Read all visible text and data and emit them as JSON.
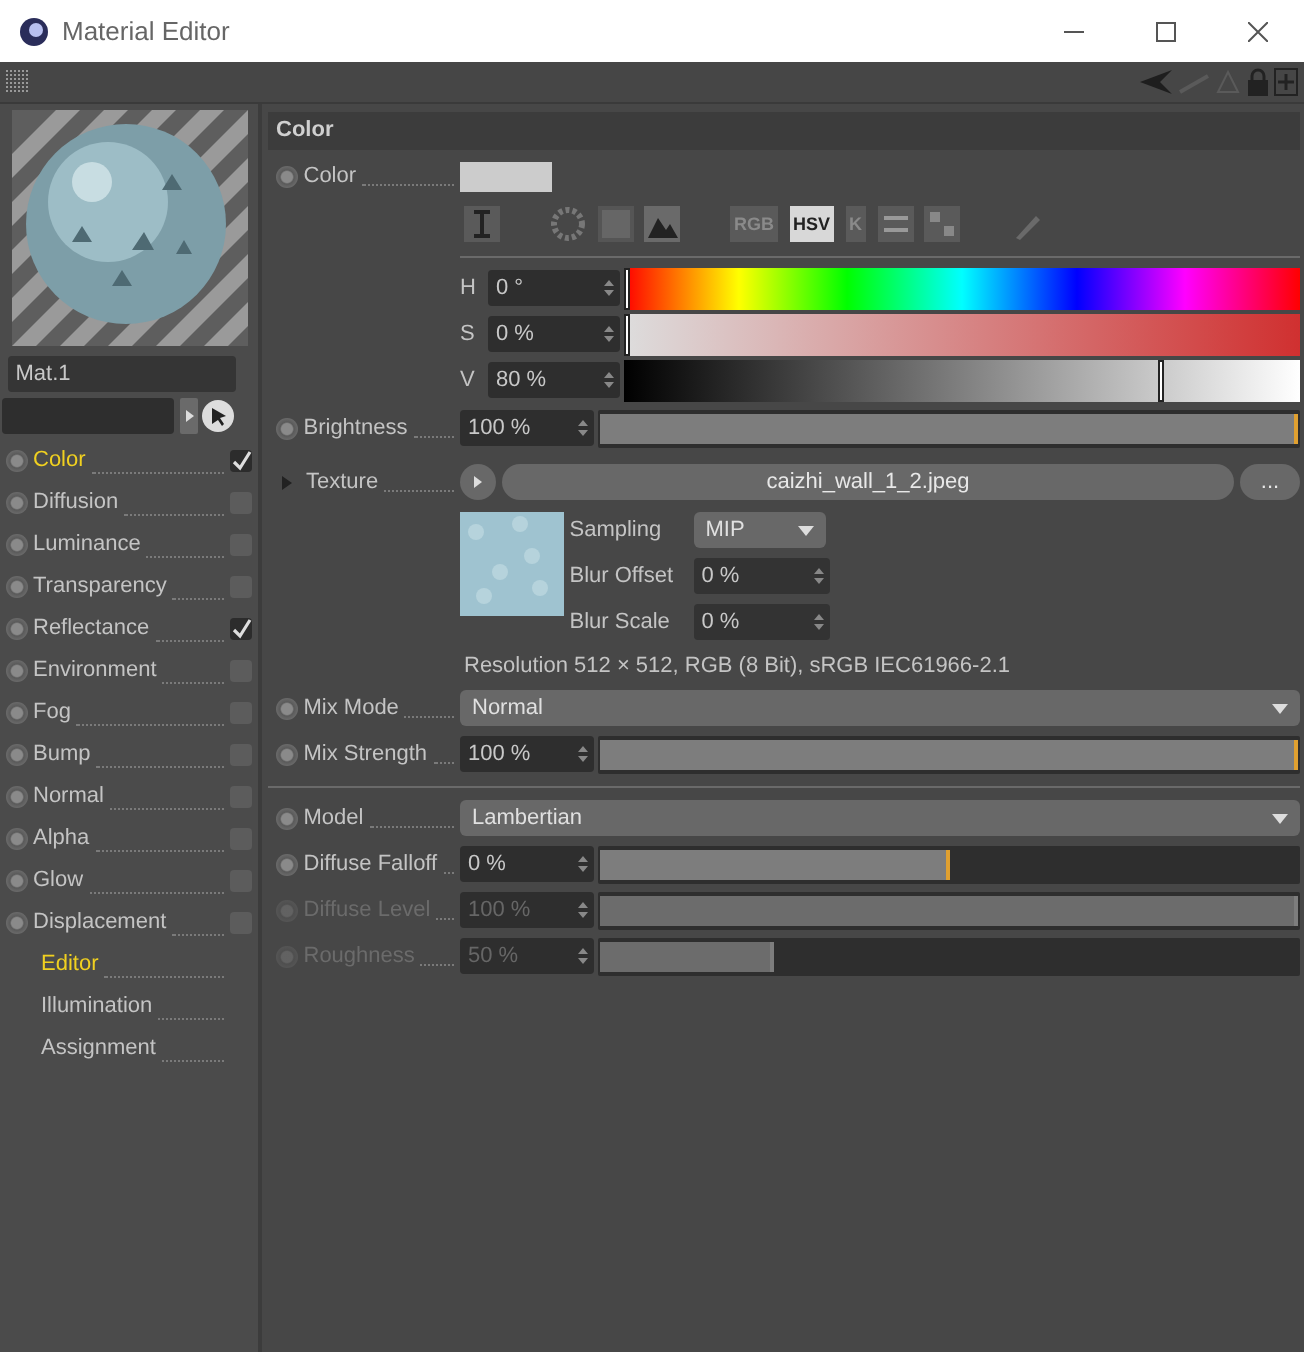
{
  "window": {
    "title": "Material Editor"
  },
  "material": {
    "name": "Mat.1"
  },
  "channels": [
    {
      "kind": "channel",
      "label": "Color",
      "checked": true,
      "selected": true
    },
    {
      "kind": "channel",
      "label": "Diffusion",
      "checked": false,
      "selected": false
    },
    {
      "kind": "channel",
      "label": "Luminance",
      "checked": false,
      "selected": false
    },
    {
      "kind": "channel",
      "label": "Transparency",
      "checked": false,
      "selected": false
    },
    {
      "kind": "channel",
      "label": "Reflectance",
      "checked": true,
      "selected": false
    },
    {
      "kind": "channel",
      "label": "Environment",
      "checked": false,
      "selected": false
    },
    {
      "kind": "channel",
      "label": "Fog",
      "checked": false,
      "selected": false
    },
    {
      "kind": "channel",
      "label": "Bump",
      "checked": false,
      "selected": false
    },
    {
      "kind": "channel",
      "label": "Normal",
      "checked": false,
      "selected": false
    },
    {
      "kind": "channel",
      "label": "Alpha",
      "checked": false,
      "selected": false
    },
    {
      "kind": "channel",
      "label": "Glow",
      "checked": false,
      "selected": false
    },
    {
      "kind": "channel",
      "label": "Displacement",
      "checked": false,
      "selected": false
    },
    {
      "kind": "page",
      "label": "Editor",
      "selected": true
    },
    {
      "kind": "page",
      "label": "Illumination",
      "selected": false
    },
    {
      "kind": "page",
      "label": "Assignment",
      "selected": false
    }
  ],
  "section": {
    "title": "Color"
  },
  "color": {
    "label": "Color",
    "modes": [
      {
        "label": "RGB",
        "selected": false
      },
      {
        "label": "HSV",
        "selected": true
      },
      {
        "label": "K",
        "selected": false
      }
    ],
    "sliders": [
      {
        "kind": "hue",
        "label": "H",
        "value": "0 °",
        "level": 0
      },
      {
        "kind": "saturation",
        "label": "S",
        "value": "0 %",
        "level": 0
      },
      {
        "kind": "value",
        "label": "V",
        "value": "80 %",
        "level": 0.8
      }
    ]
  },
  "brightness": {
    "label": "Brightness",
    "value": "100 %",
    "level": 1
  },
  "texture": {
    "label": "Texture",
    "file": "caizhi_wall_1_2.jpeg",
    "browse": "...",
    "options": [
      {
        "kind": "dropdown",
        "label": "Sampling",
        "value": "MIP"
      },
      {
        "kind": "spinner",
        "label": "Blur Offset",
        "value": "0 %"
      },
      {
        "kind": "spinner",
        "label": "Blur Scale",
        "value": "0 %"
      }
    ],
    "resolution": "Resolution 512 × 512, RGB (8 Bit), sRGB IEC61966-2.1"
  },
  "groups": [
    [
      {
        "kind": "dropdown",
        "label": "Mix Mode",
        "value": "Normal",
        "disabled": false
      },
      {
        "kind": "slider",
        "label": "Mix Strength",
        "value": "100 %",
        "level": 1,
        "disabled": false
      }
    ],
    [
      {
        "kind": "dropdown",
        "label": "Model",
        "value": "Lambertian",
        "disabled": false
      },
      {
        "kind": "slider",
        "label": "Diffuse Falloff",
        "value": "0 %",
        "level": 0.5,
        "disabled": false
      },
      {
        "kind": "slider",
        "label": "Diffuse Level",
        "value": "100 %",
        "level": 1,
        "disabled": true
      },
      {
        "kind": "slider",
        "label": "Roughness",
        "value": "50 %",
        "level": 0.25,
        "disabled": true
      }
    ]
  ]
}
